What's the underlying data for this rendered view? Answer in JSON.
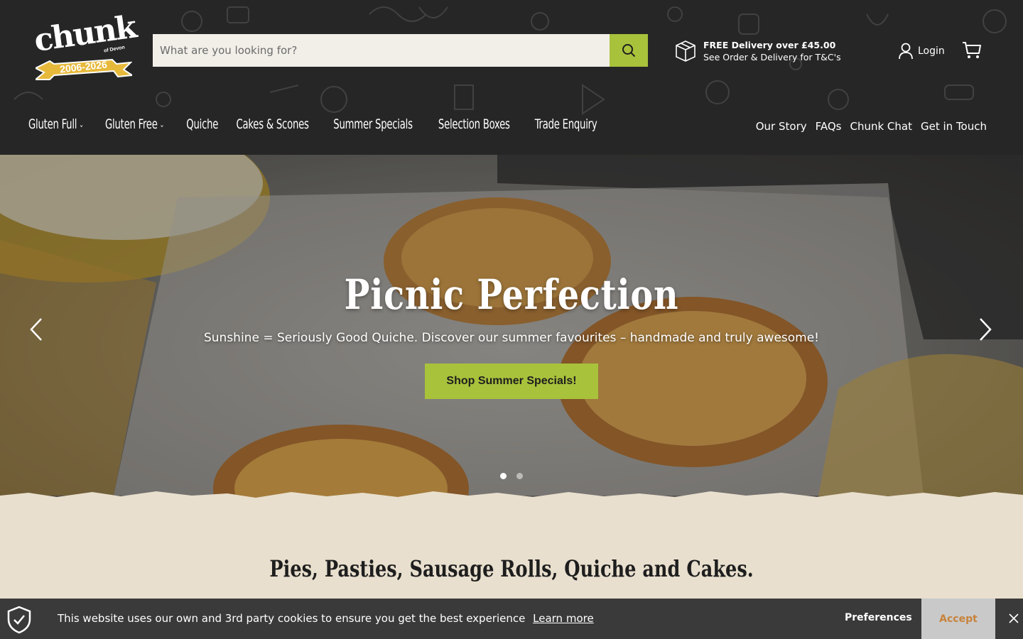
{
  "logo": {
    "word": "chunk",
    "sub": "of Devon",
    "years": "2006-2026"
  },
  "search": {
    "placeholder": "What are you looking for?",
    "icon": "search-icon"
  },
  "delivery": {
    "title": "FREE Delivery over £45.00",
    "subtitle": "See Order & Delivery for T&C's",
    "icon": "box-icon"
  },
  "account": {
    "login_label": "Login",
    "cart_icon": "cart-icon"
  },
  "main_nav": [
    {
      "label": "Gluten Full",
      "has_dropdown": true
    },
    {
      "label": "Gluten Free",
      "has_dropdown": true
    },
    {
      "label": "Quiche",
      "has_dropdown": false
    },
    {
      "label": "Cakes & Scones",
      "has_dropdown": false
    },
    {
      "label": "Summer Specials",
      "has_dropdown": false
    },
    {
      "label": "Selection Boxes",
      "has_dropdown": false
    },
    {
      "label": "Trade Enquiry",
      "has_dropdown": false
    }
  ],
  "secondary_nav": [
    {
      "label": "Our Story"
    },
    {
      "label": "FAQs"
    },
    {
      "label": "Chunk Chat"
    },
    {
      "label": "Get in Touch"
    }
  ],
  "hero": {
    "title": "Picnic Perfection",
    "subtitle": "Sunshine = Seriously Good Quiche. Discover our summer favourites – handmade and truly awesome!",
    "cta_label": "Shop Summer Specials!",
    "slide_count": 2,
    "active_slide": 1
  },
  "tagline": "Pies, Pasties, Sausage Rolls, Quiche and Cakes.",
  "cookie_bar": {
    "text": "This website uses our own and 3rd party cookies to ensure you get the best experience",
    "link_label": "Learn more",
    "preferences_label": "Preferences",
    "accept_label": "Accept"
  },
  "colors": {
    "header_bg": "#262626",
    "accent_green": "#a8c23b",
    "cream": "#e8dfce",
    "cookie_bg": "#3a3a3a",
    "accept_text": "#c8833b"
  }
}
